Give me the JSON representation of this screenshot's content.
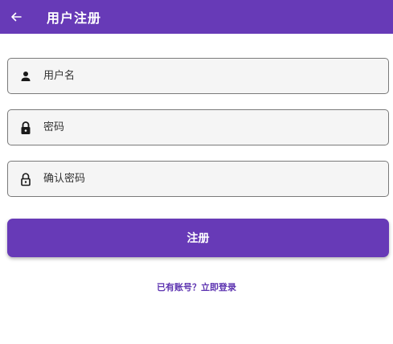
{
  "appbar": {
    "title": "用户注册",
    "back_icon": "arrow-left-icon",
    "color": "#673ab7"
  },
  "form": {
    "username": {
      "placeholder": "用户名",
      "value": "",
      "icon": "person-icon"
    },
    "password": {
      "placeholder": "密码",
      "value": "",
      "icon": "lock-filled-icon"
    },
    "confirm_password": {
      "placeholder": "确认密码",
      "value": "",
      "icon": "lock-outline-icon"
    },
    "register_label": "注册",
    "login_link": "已有账号？立即登录"
  },
  "colors": {
    "primary": "#673ab7",
    "link": "#5e35b1",
    "field_bg": "#f5f5f5",
    "field_border": "#7a7a7a"
  }
}
